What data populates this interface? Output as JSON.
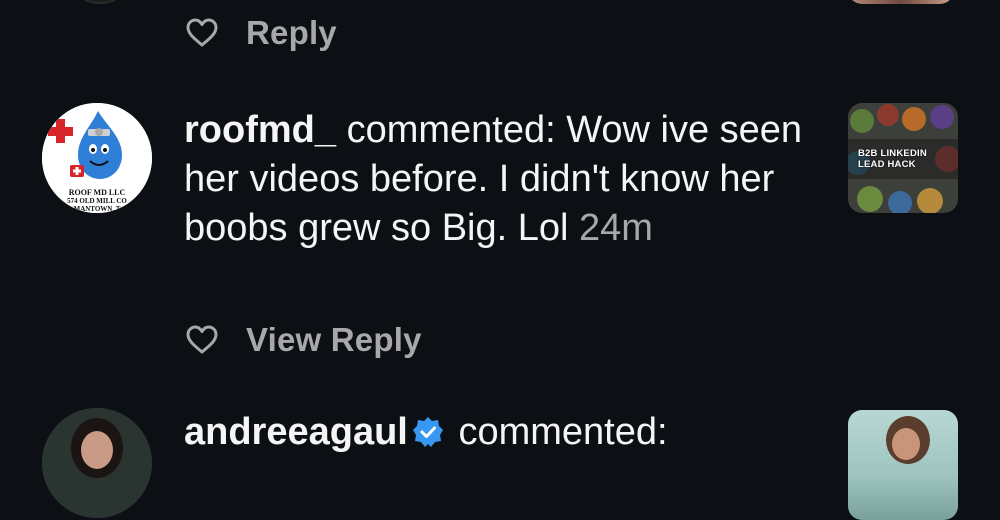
{
  "top_action": {
    "label": "Reply"
  },
  "comment": {
    "username": "roofmd_",
    "action_text": "commented:",
    "text": "Wow ive seen her videos before. I didn't know her boobs grew so Big. Lol",
    "time": "24m",
    "avatar_text": [
      "ROOF MD LLC",
      "574 OLD MILL CO",
      "MANTOWN, T"
    ],
    "thumbnail_text": [
      "B2B LINKEDIN",
      "LEAD HACK"
    ],
    "reply_label": "View Reply"
  },
  "next_comment": {
    "username": "andreeagaul",
    "action_text": "commented:"
  },
  "colors": {
    "background": "#0c1014",
    "text_primary": "#f5f5f5",
    "text_secondary": "#a8a8a8",
    "verified_blue": "#3897f0"
  },
  "icons": [
    "heart-icon",
    "verified-badge-icon"
  ]
}
